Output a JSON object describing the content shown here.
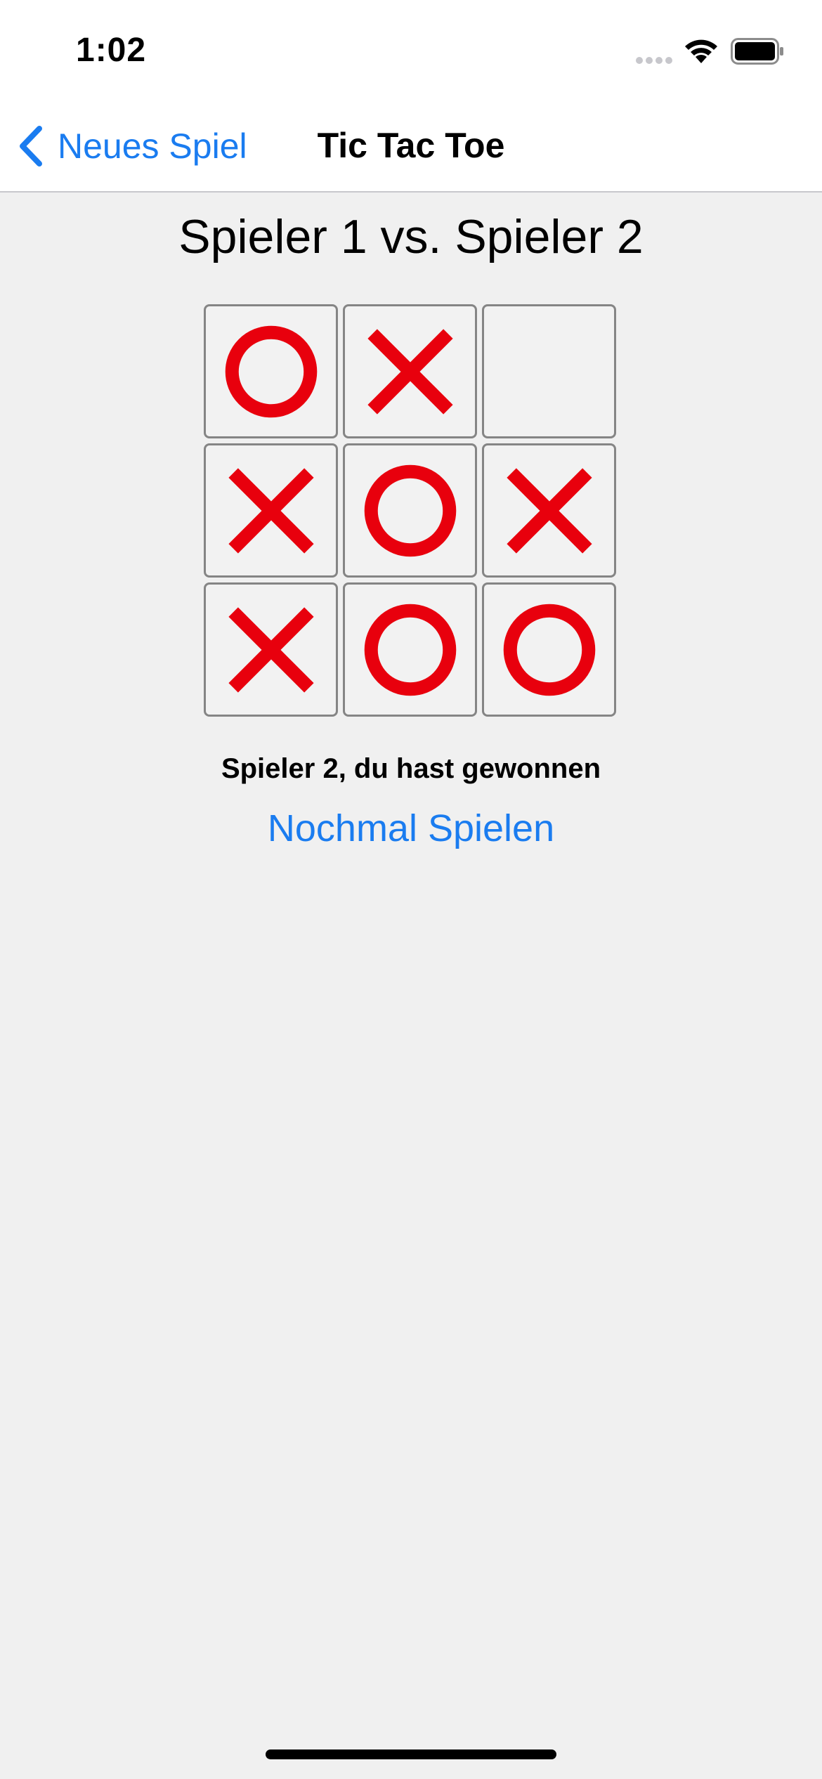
{
  "status_bar": {
    "time": "1:02"
  },
  "nav_bar": {
    "back_label": "Neues Spiel",
    "title": "Tic Tac Toe"
  },
  "game": {
    "matchup": "Spieler 1 vs. Spieler 2",
    "board": [
      [
        "O",
        "X",
        ""
      ],
      [
        "X",
        "O",
        "X"
      ],
      [
        "X",
        "O",
        "O"
      ]
    ],
    "result": "Spieler 2, du hast gewonnen",
    "play_again_label": "Nochmal Spielen"
  },
  "colors": {
    "accent": "#1a7cf0",
    "mark": "#e8000d",
    "background": "#f0f0f0"
  },
  "icons": {
    "x_mark": "x-mark-icon",
    "o_mark": "o-mark-icon",
    "back": "chevron-left-icon",
    "wifi": "wifi-icon",
    "battery": "battery-icon",
    "signal": "signal-icon"
  }
}
